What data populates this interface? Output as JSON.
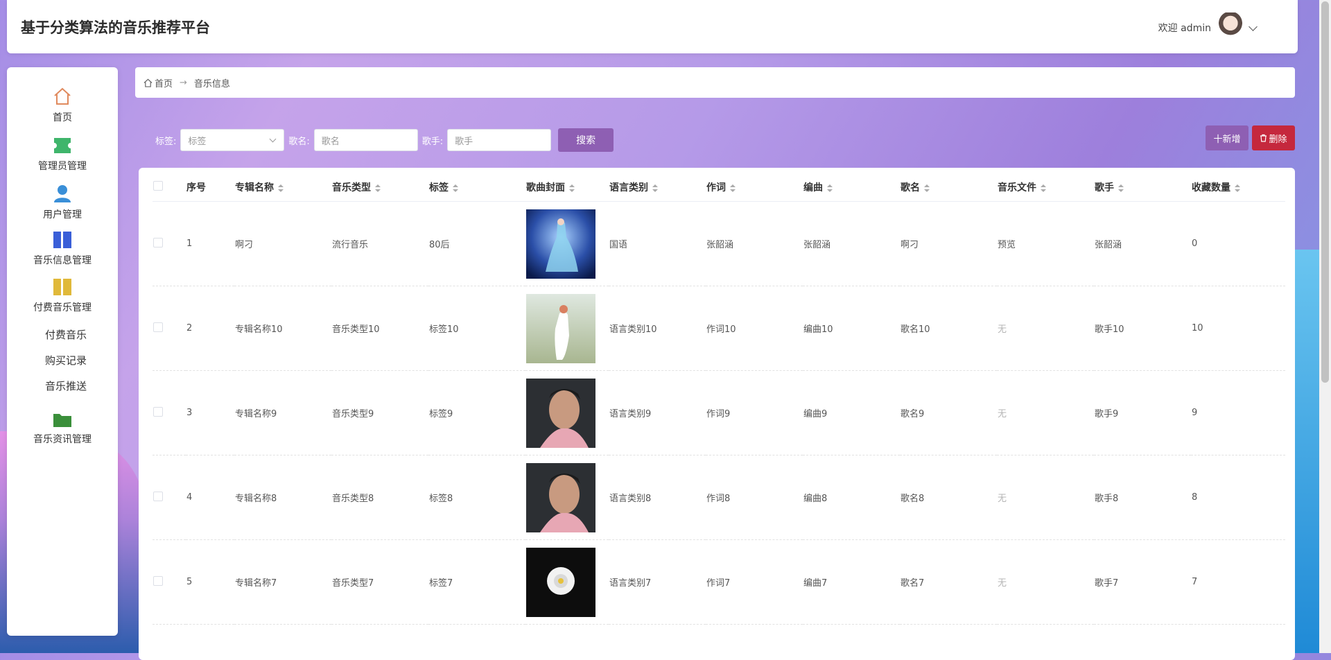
{
  "header": {
    "title": "基于分类算法的音乐推荐平台",
    "welcome": "欢迎 admin"
  },
  "sidebar": {
    "items": [
      {
        "label": "首页",
        "icon": "home-icon",
        "color": "#e08a5e"
      },
      {
        "label": "管理员管理",
        "icon": "ticket-icon",
        "color": "#3fb56b"
      },
      {
        "label": "用户管理",
        "icon": "user-icon",
        "color": "#3a8fd8"
      },
      {
        "label": "音乐信息管理",
        "icon": "columns-icon",
        "color": "#3a5fd8"
      },
      {
        "label": "付费音乐管理",
        "icon": "columns-icon",
        "color": "#e0b93a"
      },
      {
        "label": "音乐资讯管理",
        "icon": "folder-icon",
        "color": "#3a8f3a"
      }
    ],
    "subitems": [
      "付费音乐",
      "购买记录",
      "音乐推送"
    ]
  },
  "breadcrumb": {
    "home": "首页",
    "current": "音乐信息"
  },
  "search": {
    "tag_label": "标签:",
    "tag_placeholder": "标签",
    "song_label": "歌名:",
    "song_placeholder": "歌名",
    "singer_label": "歌手:",
    "singer_placeholder": "歌手",
    "search_button": "搜索"
  },
  "actions": {
    "add": "十新增",
    "delete": "删除"
  },
  "table": {
    "columns": [
      "序号",
      "专辑名称",
      "音乐类型",
      "标签",
      "歌曲封面",
      "语言类别",
      "作词",
      "编曲",
      "歌名",
      "音乐文件",
      "歌手",
      "收藏数量"
    ],
    "rows": [
      {
        "no": "1",
        "album": "啊刁",
        "type": "流行音乐",
        "tag": "80后",
        "lang": "国语",
        "lyric": "张韶涵",
        "arr": "张韶涵",
        "song": "啊刁",
        "file": "预览",
        "singer": "张韶涵",
        "fav": "0"
      },
      {
        "no": "2",
        "album": "专辑名称10",
        "type": "音乐类型10",
        "tag": "标签10",
        "lang": "语言类别10",
        "lyric": "作词10",
        "arr": "编曲10",
        "song": "歌名10",
        "file": "无",
        "singer": "歌手10",
        "fav": "10"
      },
      {
        "no": "3",
        "album": "专辑名称9",
        "type": "音乐类型9",
        "tag": "标签9",
        "lang": "语言类别9",
        "lyric": "作词9",
        "arr": "编曲9",
        "song": "歌名9",
        "file": "无",
        "singer": "歌手9",
        "fav": "9"
      },
      {
        "no": "4",
        "album": "专辑名称8",
        "type": "音乐类型8",
        "tag": "标签8",
        "lang": "语言类别8",
        "lyric": "作词8",
        "arr": "编曲8",
        "song": "歌名8",
        "file": "无",
        "singer": "歌手8",
        "fav": "8"
      },
      {
        "no": "5",
        "album": "专辑名称7",
        "type": "音乐类型7",
        "tag": "标签7",
        "lang": "语言类别7",
        "lyric": "作词7",
        "arr": "编曲7",
        "song": "歌名7",
        "file": "无",
        "singer": "歌手7",
        "fav": "7"
      }
    ]
  }
}
